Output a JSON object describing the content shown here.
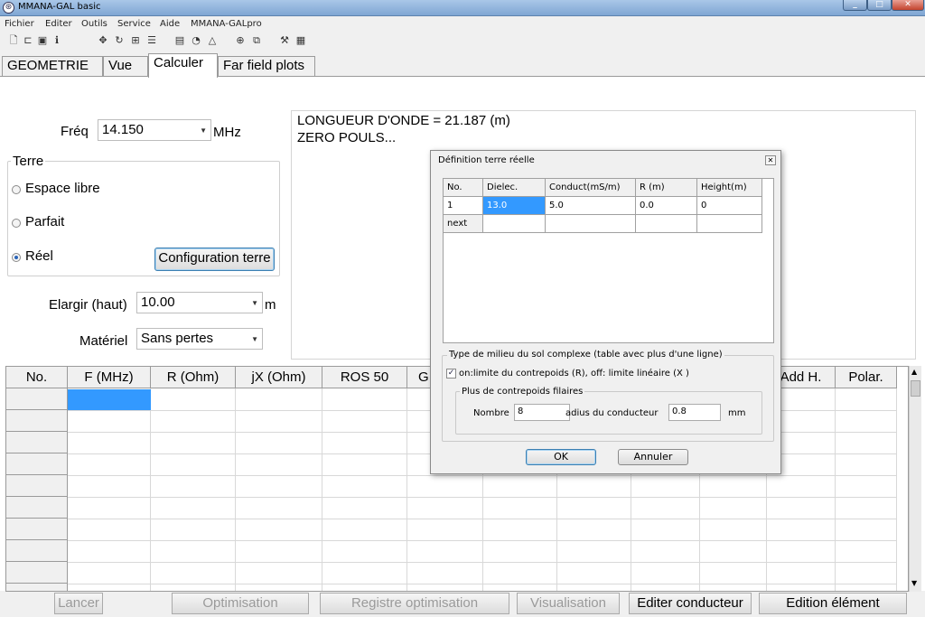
{
  "window": {
    "title": "MMANA-GAL basic"
  },
  "menu": [
    "Fichier",
    "Editer",
    "Outils",
    "Service",
    "Aide",
    "MMANA-GALpro"
  ],
  "toolbar_icons": [
    "new-file-icon",
    "open-folder-icon",
    "save-icon",
    "info-icon",
    "move-icon",
    "rotate-icon",
    "stretch-icon",
    "align-icon",
    "document-icon",
    "chart-icon",
    "triangle-icon",
    "target-icon",
    "copy-icon",
    "tools-icon",
    "calculator-icon"
  ],
  "tabs": [
    "GEOMETRIE",
    "Vue",
    "Calculer",
    "Far field plots"
  ],
  "active_tab": "Calculer",
  "calc": {
    "freq_label": "Fréq",
    "freq_value": "14.150",
    "freq_unit": "MHz",
    "terre_label": "Terre",
    "radio_espace": "Espace libre",
    "radio_parfait": "Parfait",
    "radio_reel": "Réel",
    "selected_ground": "Réel",
    "config_button": "Configuration terre",
    "elargir_label": "Elargir (haut)",
    "elargir_value": "10.00",
    "elargir_unit": "m",
    "materiel_label": "Matériel",
    "materiel_value": "Sans pertes"
  },
  "output": {
    "line1": "LONGUEUR D'ONDE = 21.187 (m)",
    "line2": "ZERO POULS..."
  },
  "grid": {
    "headers": [
      "No.",
      "F (MHz)",
      "R (Ohm)",
      "jX (Ohm)",
      "ROS  50",
      "G",
      "Add H.",
      "Polar."
    ]
  },
  "bottom_buttons": {
    "lancer": "Lancer",
    "optimisation": "Optimisation",
    "registre": "Registre optimisation",
    "visualisation": "Visualisation",
    "editer_conducteur": "Editer conducteur",
    "edition_element": "Edition élément"
  },
  "dialog": {
    "title": "Définition terre réelle",
    "table_headers": [
      "No.",
      "Dielec.",
      "Conduct(mS/m)",
      "R (m)",
      "Height(m)"
    ],
    "rows": [
      [
        "1",
        "13.0",
        "5.0",
        "0.0",
        "0"
      ],
      [
        "next",
        "",
        "",
        "",
        ""
      ]
    ],
    "group1_label": "Type de milieu du sol complexe (table avec plus d'une ligne)",
    "checkbox_label": "on:limite du contrepoids (R), off: limite linéaire (X )",
    "checkbox_checked": true,
    "group2_label": "Plus de contrepoids filaires",
    "nombre_label": "Nombre",
    "nombre_value": "8",
    "radius_label": "adius du conducteur",
    "radius_value": "0.8",
    "radius_unit": "mm",
    "ok": "OK",
    "cancel": "Annuler"
  },
  "colors": {
    "selection": "#3399ff",
    "titlebar": "#7fa6d3"
  }
}
